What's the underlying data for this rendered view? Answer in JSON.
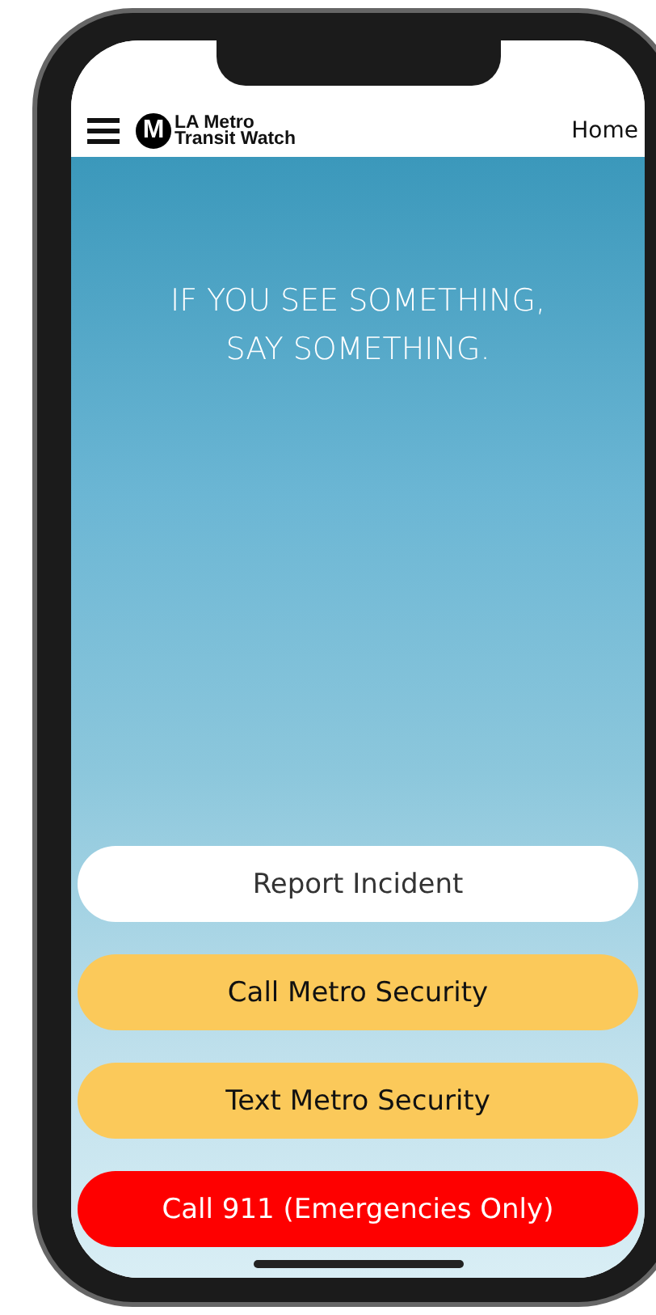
{
  "header": {
    "logo_letter": "M",
    "logo_text": [
      "LA Metro",
      "Transit Watch"
    ],
    "nav_link": "Home"
  },
  "hero": {
    "headline": [
      "IF YOU SEE SOMETHING,",
      "SAY SOMETHING."
    ]
  },
  "buttons": [
    {
      "label": "Report Incident",
      "kind": "neutral"
    },
    {
      "label": "Call Metro Security",
      "kind": "security"
    },
    {
      "label": "Text Metro Security",
      "kind": "security"
    },
    {
      "label": "Call 911 (Emergencies Only)",
      "kind": "emergency"
    }
  ]
}
